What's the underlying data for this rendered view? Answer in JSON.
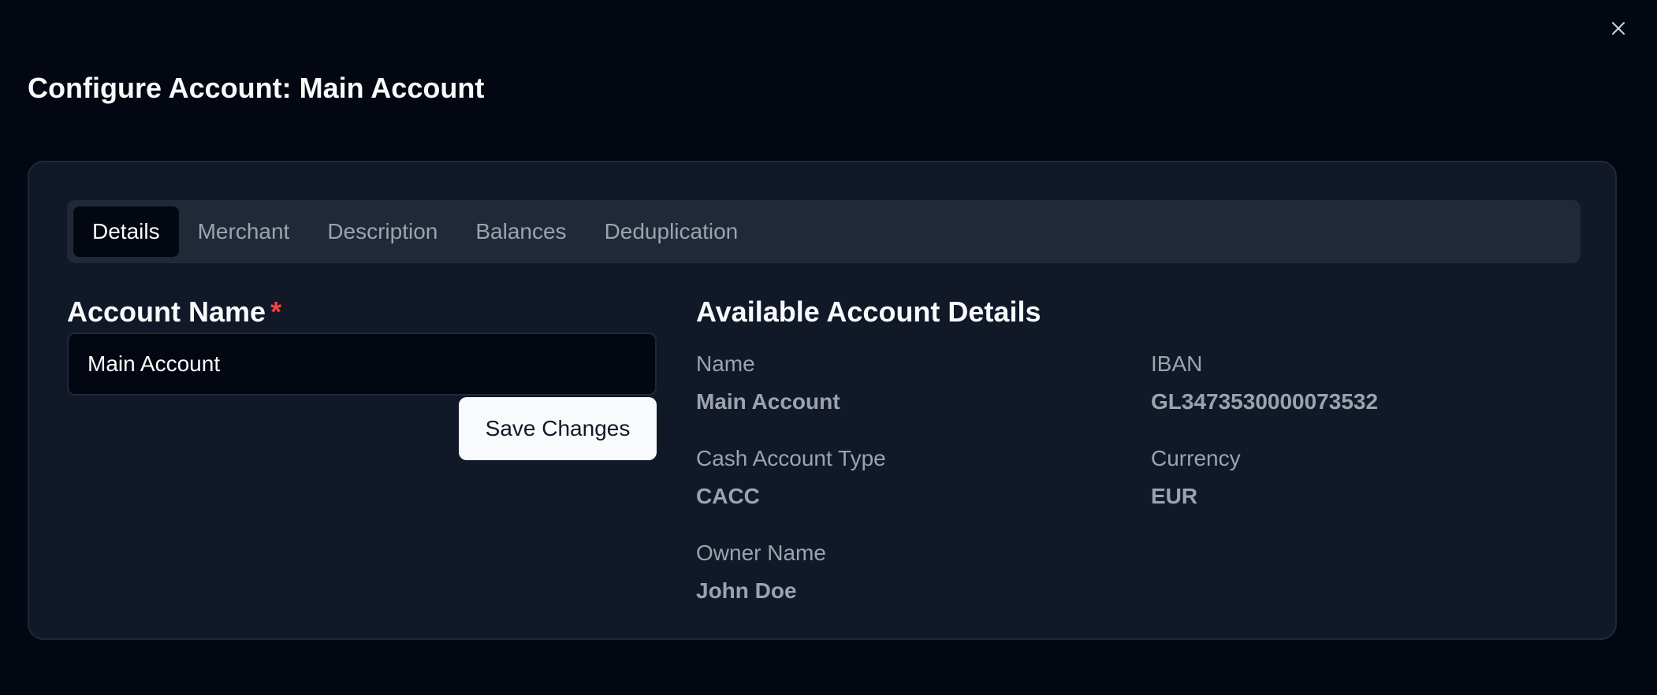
{
  "dialog": {
    "title": "Configure Account: Main Account",
    "close_icon": "close-icon"
  },
  "tabs": [
    {
      "label": "Details",
      "active": true
    },
    {
      "label": "Merchant",
      "active": false
    },
    {
      "label": "Description",
      "active": false
    },
    {
      "label": "Balances",
      "active": false
    },
    {
      "label": "Deduplication",
      "active": false
    }
  ],
  "form": {
    "account_name_label": "Account Name",
    "required_marker": "*",
    "account_name_value": "Main Account",
    "save_label": "Save Changes"
  },
  "available_details": {
    "title": "Available Account Details",
    "items": [
      {
        "label": "Name",
        "value": "Main Account"
      },
      {
        "label": "IBAN",
        "value": "GL3473530000073532"
      },
      {
        "label": "Cash Account Type",
        "value": "CACC"
      },
      {
        "label": "Currency",
        "value": "EUR"
      },
      {
        "label": "Owner Name",
        "value": "John Doe"
      }
    ]
  },
  "colors": {
    "background": "#030712",
    "card": "#111827",
    "tab_bar": "#1f2937",
    "required": "#ef4444",
    "button": "#f9fafb"
  }
}
